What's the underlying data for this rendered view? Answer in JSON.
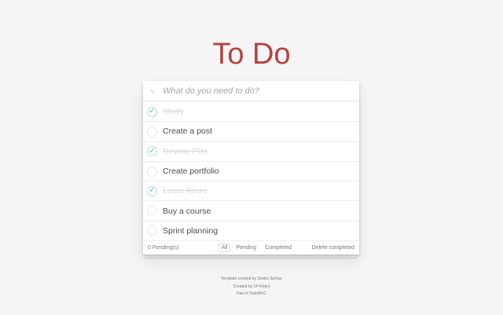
{
  "title": "To Do",
  "new_todo": {
    "placeholder": "What do you need to do?",
    "value": ""
  },
  "toggle_all_icon": "chevron-down-icon",
  "todos": [
    {
      "label": "Study",
      "completed": true
    },
    {
      "label": "Create a post",
      "completed": false
    },
    {
      "label": "Review PRs",
      "completed": true
    },
    {
      "label": "Create portfolio",
      "completed": false
    },
    {
      "label": "Learn Azure",
      "completed": true
    },
    {
      "label": "Buy a course",
      "completed": false
    },
    {
      "label": "Sprint planning",
      "completed": false
    }
  ],
  "footer": {
    "pending_count": "0 Pending(s)",
    "filters": [
      {
        "label": "All",
        "selected": true
      },
      {
        "label": "Pending",
        "selected": false
      },
      {
        "label": "Completed",
        "selected": false
      }
    ],
    "clear_label": "Delete completed"
  },
  "info": [
    "Template created by Sindre Sorhus",
    "Created by LP-React",
    "Part of TodoMVC"
  ],
  "colors": {
    "title": "#af2f2f",
    "background": "#f5f5f5",
    "check": "#5dc2af",
    "completed_text": "#d9d9d9"
  }
}
